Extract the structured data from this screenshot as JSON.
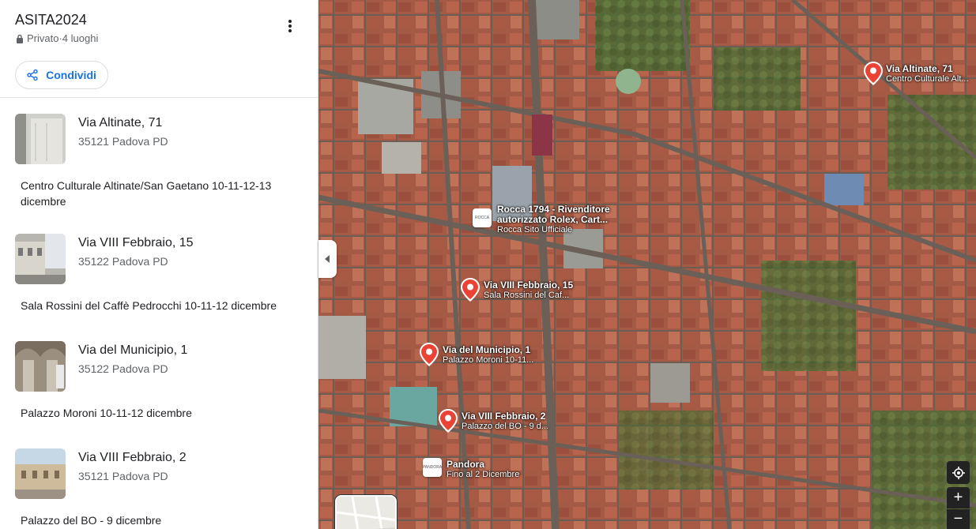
{
  "list": {
    "title": "ASITA2024",
    "meta": "Privato·4 luoghi",
    "share_label": "Condividi"
  },
  "places": [
    {
      "name": "Via Altinate, 71",
      "address": "35121 Padova PD",
      "note": "Centro Culturale Altinate/San Gaetano 10-11-12-13 dicembre"
    },
    {
      "name": "Via VIII Febbraio, 15",
      "address": "35122 Padova PD",
      "note": "Sala Rossini del Caffè Pedrocchi 10-11-12 dicembre"
    },
    {
      "name": "Via del Municipio, 1",
      "address": "35122 Padova PD",
      "note": "Palazzo Moroni 10-11-12 dicembre"
    },
    {
      "name": "Via VIII Febbraio, 2",
      "address": "35121 Padova PD",
      "note": "Palazzo del BO - 9 dicembre"
    }
  ],
  "map": {
    "pins": [
      {
        "title": "Via Altinate, 71",
        "subtitle": "Centro Culturale Alt..."
      },
      {
        "title": "Via VIII Febbraio, 15",
        "subtitle": "Sala Rossini del Caf..."
      },
      {
        "title": "Via del Municipio, 1",
        "subtitle": "Palazzo Moroni 10-11..."
      },
      {
        "title": "Via VIII Febbraio, 2",
        "subtitle": "Palazzo del BO - 9 d..."
      }
    ],
    "pois": [
      {
        "title_line1": "Rocca 1794 - Rivenditore",
        "title_line2": "autorizzato Rolex, Cart...",
        "subtitle": "Rocca Sito Ufficiale",
        "logo": "ROCCA"
      },
      {
        "title_line1": "Pandora",
        "subtitle": "Fino al 2 Dicembre",
        "logo": "PANDORA"
      }
    ],
    "zoom_in": "+",
    "zoom_out": "−"
  },
  "colors": {
    "accent": "#1a73e8",
    "pin": "#ea4335"
  }
}
